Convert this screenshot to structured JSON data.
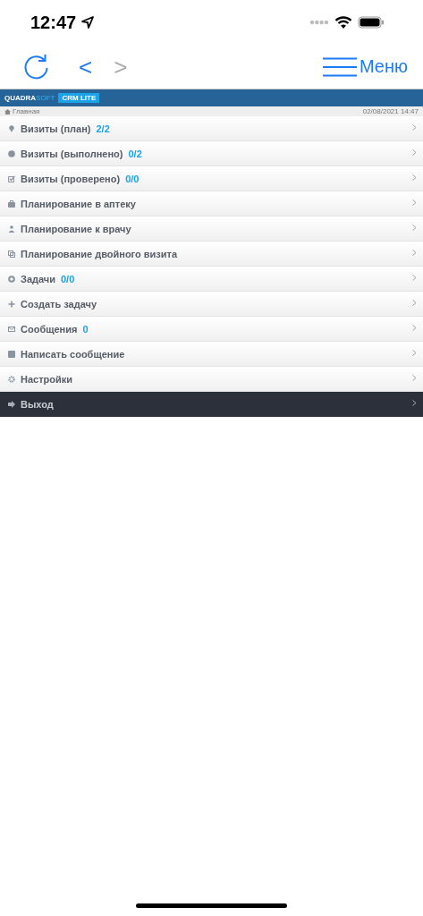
{
  "status_bar": {
    "time": "12:47"
  },
  "toolbar": {
    "back_enabled": true,
    "forward_enabled": false,
    "back": "<",
    "forward": ">",
    "menu": "Меню"
  },
  "header": {
    "brand": "QUADRA",
    "brand_accent": "SOFT",
    "badge": "CRM LITE"
  },
  "breadcrumb": {
    "label": "Главная",
    "datetime": "02/08/2021 14:47"
  },
  "menu_items": [
    {
      "kind": "normal",
      "label": "Визиты (план)",
      "count": "2/2"
    },
    {
      "kind": "normal",
      "label": "Визиты (выполнено)",
      "count": "0/2"
    },
    {
      "kind": "normal",
      "label": "Визиты (проверено)",
      "count": "0/0"
    },
    {
      "kind": "normal",
      "label": "Планирование в аптеку"
    },
    {
      "kind": "normal",
      "label": "Планирование к врачу"
    },
    {
      "kind": "normal",
      "label": "Планирование двойного визита"
    },
    {
      "kind": "normal",
      "label": "Задачи",
      "count": "0/0"
    },
    {
      "kind": "normal",
      "label": "Создать задачу"
    },
    {
      "kind": "normal",
      "label": "Сообщения",
      "count": "0"
    },
    {
      "kind": "normal",
      "label": "Написать сообщение"
    },
    {
      "kind": "normal",
      "label": "Настройки"
    },
    {
      "kind": "exit",
      "label": "Выход"
    }
  ]
}
